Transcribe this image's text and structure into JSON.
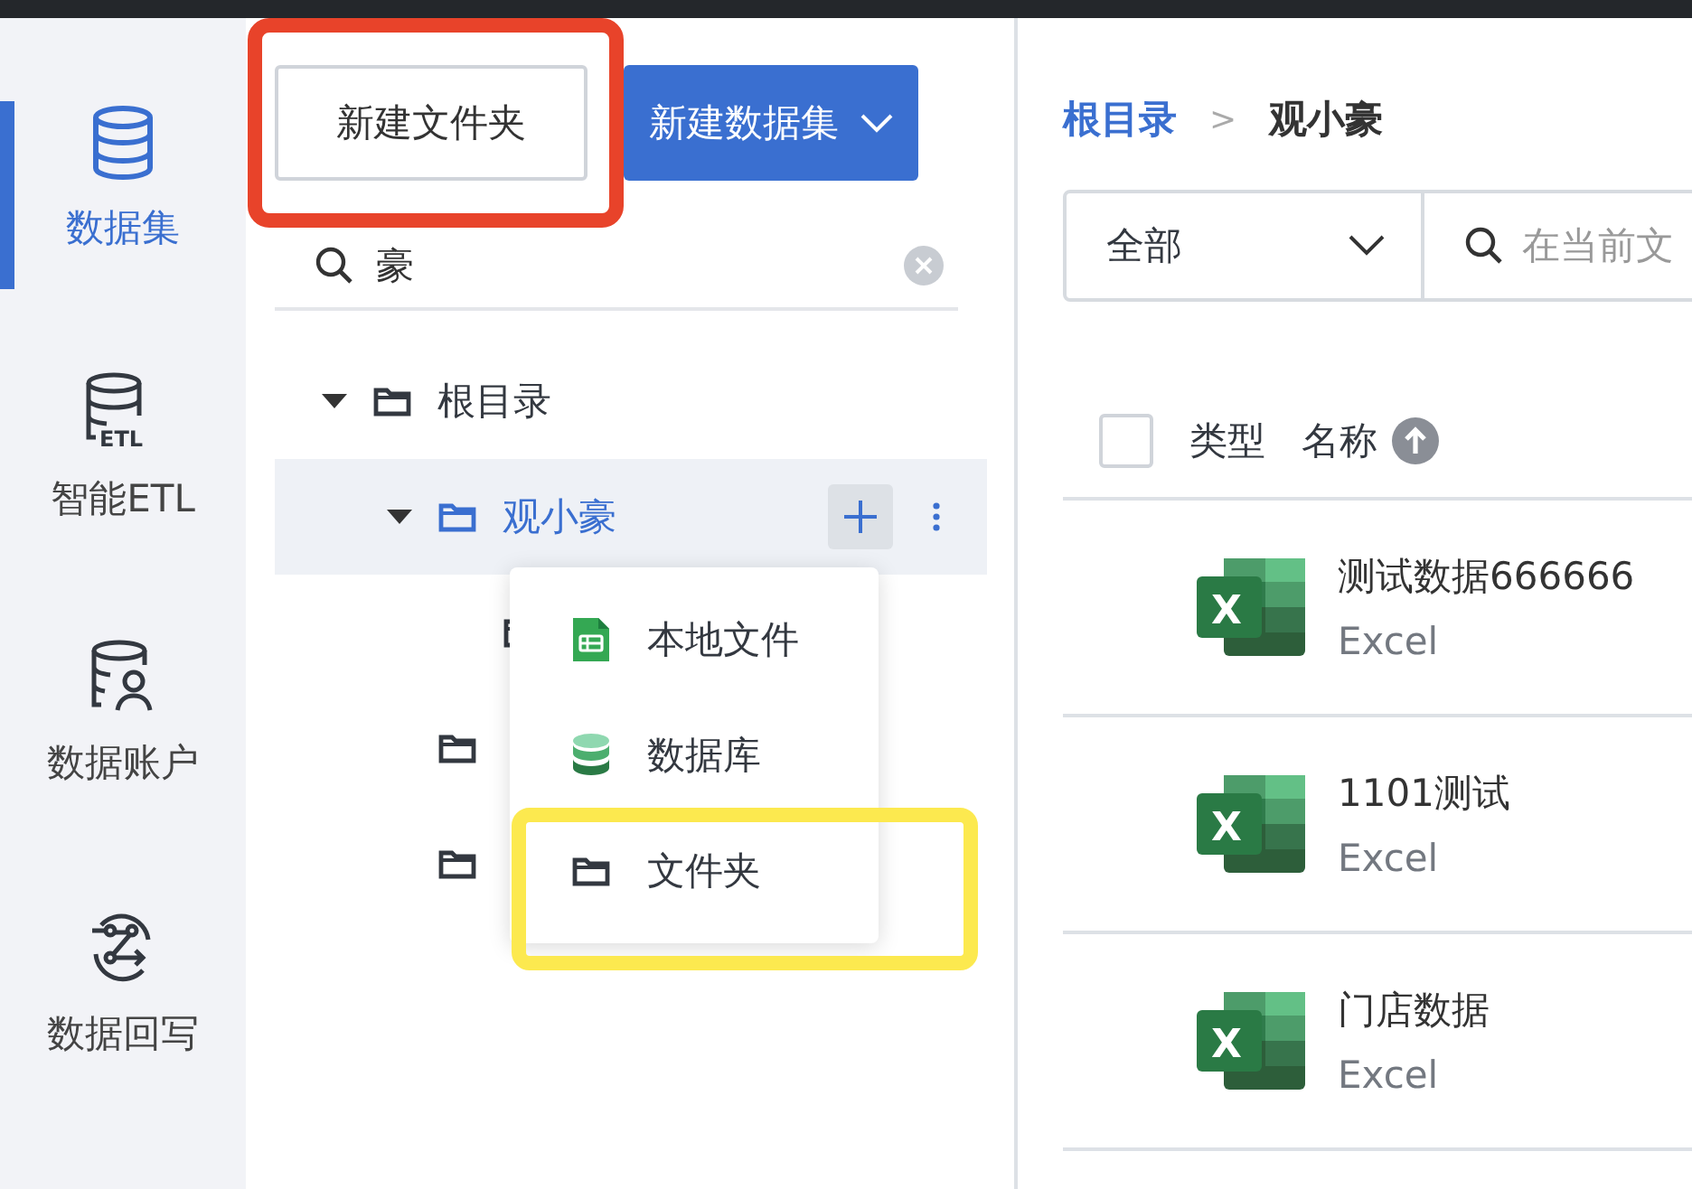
{
  "sidebar": {
    "items": [
      {
        "kind": "database",
        "label": "数据集",
        "selected": true
      },
      {
        "kind": "etl",
        "label": "智能ETL",
        "icon_text": "ETL",
        "selected": false
      },
      {
        "kind": "account",
        "label": "数据账户",
        "selected": false
      },
      {
        "kind": "writeback",
        "label": "数据回写",
        "selected": false
      }
    ]
  },
  "toolbar": {
    "buttons": [
      {
        "kind": "outline",
        "label": "新建文件夹",
        "highlighted": true
      },
      {
        "kind": "primary",
        "label": "新建数据集",
        "highlighted": false
      }
    ]
  },
  "tree_search": {
    "value": "豪"
  },
  "tree": [
    {
      "name": "根目录",
      "expanded": true,
      "selected": false,
      "children": [
        {
          "name": "观小豪",
          "expanded": true,
          "selected": true,
          "children": [
            {
              "kind": "folder"
            }
          ]
        },
        {
          "kind": "folder"
        },
        {
          "kind": "folder"
        }
      ]
    }
  ],
  "add_menu": {
    "items": [
      {
        "kind": "file",
        "label": "本地文件",
        "highlighted": false
      },
      {
        "kind": "database",
        "label": "数据库",
        "highlighted": false
      },
      {
        "kind": "folder",
        "label": "文件夹",
        "highlighted": true
      }
    ]
  },
  "breadcrumb": [
    {
      "label": "根目录",
      "current": false
    },
    {
      "separator": ">",
      "label": "观小豪",
      "current": true
    }
  ],
  "filter": {
    "value": "全部"
  },
  "search": {
    "placeholder": "在当前文"
  },
  "table": {
    "columns": [
      "类型",
      "名称"
    ],
    "select_all": false,
    "rows": [
      {
        "icon_letter": "X",
        "name": "测试数据666666",
        "type": "Excel"
      },
      {
        "icon_letter": "X",
        "name": "1101测试",
        "type": "Excel"
      },
      {
        "icon_letter": "X",
        "name": "门店数据",
        "type": "Excel"
      }
    ]
  }
}
